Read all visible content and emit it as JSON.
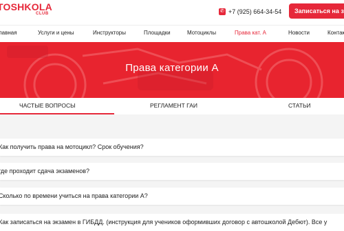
{
  "header": {
    "logo": {
      "main": "TOSHKOLA",
      "sub": "CLUB"
    },
    "phone": "+7 (925) 664-34-54",
    "cta_label": "Записаться на з"
  },
  "nav": {
    "items": [
      {
        "label": "лавная"
      },
      {
        "label": "Услуги и цены"
      },
      {
        "label": "Инструкторы"
      },
      {
        "label": "Площадки"
      },
      {
        "label": "Мотоциклы"
      },
      {
        "label": "Права кат. А",
        "active": true
      },
      {
        "label": "Новости"
      },
      {
        "label": "Контак"
      }
    ]
  },
  "hero": {
    "title": "Права категории А"
  },
  "tabs": [
    {
      "label": "ЧАСТЫЕ ВОПРОСЫ",
      "active": true
    },
    {
      "label": "РЕГЛАМЕНТ ГАИ"
    },
    {
      "label": "СТАТЬИ"
    }
  ],
  "faq": [
    {
      "text": "Как получить права на мотоцикл? Срок обучения?"
    },
    {
      "text": "где проходит сдача экзаменов?"
    },
    {
      "text": "Сколько по времени учиться на права категории А?"
    },
    {
      "text": "Как записаться на экзамен в ГИБДД. (инструкция для учеников оформивших договор с автошколой Дебют). Все у"
    }
  ],
  "colors": {
    "accent": "#e6283a",
    "hero_bg": "#e8242f"
  }
}
